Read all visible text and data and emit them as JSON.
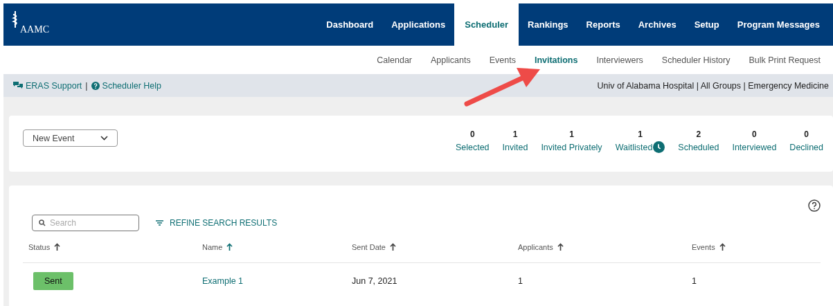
{
  "logo": {
    "text": "AAMC"
  },
  "main_nav": [
    {
      "label": "Dashboard",
      "selected": false
    },
    {
      "label": "Applications",
      "selected": false
    },
    {
      "label": "Scheduler",
      "selected": true
    },
    {
      "label": "Rankings",
      "selected": false
    },
    {
      "label": "Reports",
      "selected": false
    },
    {
      "label": "Archives",
      "selected": false
    },
    {
      "label": "Setup",
      "selected": false
    },
    {
      "label": "Program Messages",
      "selected": false
    }
  ],
  "sub_nav": [
    {
      "label": "Calendar",
      "selected": false
    },
    {
      "label": "Applicants",
      "selected": false
    },
    {
      "label": "Events",
      "selected": false
    },
    {
      "label": "Invitations",
      "selected": true
    },
    {
      "label": "Interviewers",
      "selected": false
    },
    {
      "label": "Scheduler History",
      "selected": false
    },
    {
      "label": "Bulk Print Request",
      "selected": false
    }
  ],
  "info_bar": {
    "support_link": "ERAS Support",
    "separator": "|",
    "help_link": "Scheduler Help",
    "context": "Univ of Alabama Hospital | All Groups | Emergency Medicine"
  },
  "event_select": {
    "value": "New Event"
  },
  "stats": [
    {
      "count": "0",
      "label": "Selected",
      "clock": false
    },
    {
      "count": "1",
      "label": "Invited",
      "clock": false
    },
    {
      "count": "1",
      "label": "Invited Privately",
      "clock": false
    },
    {
      "count": "1",
      "label": "Waitlisted",
      "clock": true
    },
    {
      "count": "2",
      "label": "Scheduled",
      "clock": false
    },
    {
      "count": "0",
      "label": "Interviewed",
      "clock": false
    },
    {
      "count": "0",
      "label": "Declined",
      "clock": false
    }
  ],
  "search": {
    "placeholder": "Search"
  },
  "refine_button": "REFINE SEARCH RESULTS",
  "table": {
    "columns": [
      {
        "label": "Status",
        "sorted": false
      },
      {
        "label": "Name",
        "sorted": true
      },
      {
        "label": "Sent Date",
        "sorted": false
      },
      {
        "label": "Applicants",
        "sorted": false
      },
      {
        "label": "Events",
        "sorted": false
      }
    ],
    "rows": [
      {
        "status": "Sent",
        "name": "Example 1",
        "sent_date": "Jun 7, 2021",
        "applicants": "1",
        "events": "1"
      }
    ]
  }
}
